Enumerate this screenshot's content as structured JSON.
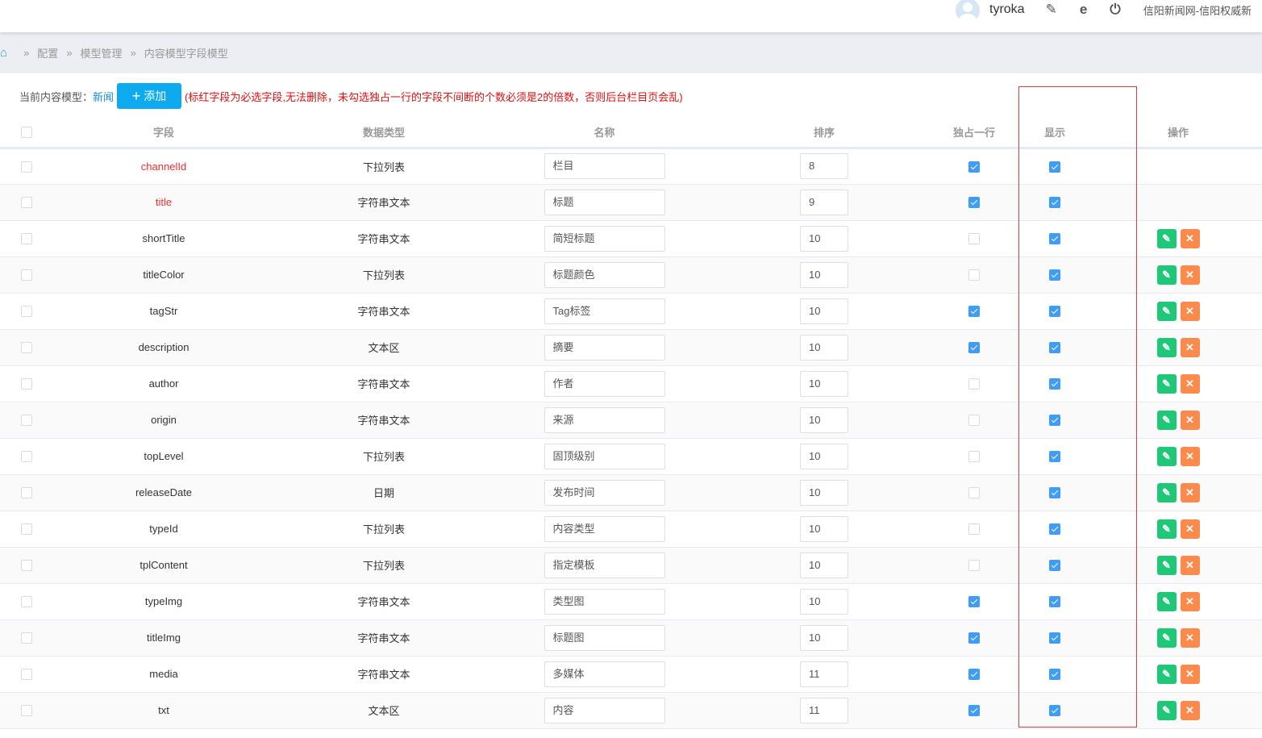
{
  "header": {
    "user": "tyroka",
    "site_title": "信阳新闻网-信阳权威新",
    "icons": [
      "user-avatar",
      "user-edit-icon",
      "ie-browser-icon",
      "power-icon"
    ]
  },
  "breadcrumb": [
    "配置",
    "模型管理",
    "内容模型字段模型"
  ],
  "toolbar": {
    "label": "当前内容模型：",
    "model": "新闻",
    "add_label": "添加",
    "warning": "(标红字段为必选字段,无法删除，未勾选独占一行的字段不间断的个数必须是2的倍数，否则后台栏目页会乱)"
  },
  "columns": [
    "字段",
    "数据类型",
    "名称",
    "排序",
    "独占一行",
    "显示",
    "操作"
  ],
  "colors": {
    "accent": "#0eaaf0",
    "required": "#f03030",
    "edit": "#1ec877",
    "delete": "#fd8a4d",
    "checkbox": "#3f9df5"
  },
  "rows": [
    {
      "field": "channelId",
      "type": "下拉列表",
      "name": "栏目",
      "order": "8",
      "exclusive": true,
      "show": true,
      "required": true
    },
    {
      "field": "title",
      "type": "字符串文本",
      "name": "标题",
      "order": "9",
      "exclusive": true,
      "show": true,
      "required": true
    },
    {
      "field": "shortTitle",
      "type": "字符串文本",
      "name": "简短标题",
      "order": "10",
      "exclusive": false,
      "show": true,
      "required": false
    },
    {
      "field": "titleColor",
      "type": "下拉列表",
      "name": "标题颜色",
      "order": "10",
      "exclusive": false,
      "show": true,
      "required": false
    },
    {
      "field": "tagStr",
      "type": "字符串文本",
      "name": "Tag标签",
      "order": "10",
      "exclusive": true,
      "show": true,
      "required": false
    },
    {
      "field": "description",
      "type": "文本区",
      "name": "摘要",
      "order": "10",
      "exclusive": true,
      "show": true,
      "required": false
    },
    {
      "field": "author",
      "type": "字符串文本",
      "name": "作者",
      "order": "10",
      "exclusive": false,
      "show": true,
      "required": false
    },
    {
      "field": "origin",
      "type": "字符串文本",
      "name": "来源",
      "order": "10",
      "exclusive": false,
      "show": true,
      "required": false
    },
    {
      "field": "topLevel",
      "type": "下拉列表",
      "name": "固顶级别",
      "order": "10",
      "exclusive": false,
      "show": true,
      "required": false
    },
    {
      "field": "releaseDate",
      "type": "日期",
      "name": "发布时间",
      "order": "10",
      "exclusive": false,
      "show": true,
      "required": false
    },
    {
      "field": "typeId",
      "type": "下拉列表",
      "name": "内容类型",
      "order": "10",
      "exclusive": false,
      "show": true,
      "required": false
    },
    {
      "field": "tplContent",
      "type": "下拉列表",
      "name": "指定模板",
      "order": "10",
      "exclusive": false,
      "show": true,
      "required": false
    },
    {
      "field": "typeImg",
      "type": "字符串文本",
      "name": "类型图",
      "order": "10",
      "exclusive": true,
      "show": true,
      "required": false
    },
    {
      "field": "titleImg",
      "type": "字符串文本",
      "name": "标题图",
      "order": "10",
      "exclusive": true,
      "show": true,
      "required": false
    },
    {
      "field": "media",
      "type": "字符串文本",
      "name": "多媒体",
      "order": "11",
      "exclusive": true,
      "show": true,
      "required": false
    },
    {
      "field": "txt",
      "type": "文本区",
      "name": "内容",
      "order": "11",
      "exclusive": true,
      "show": true,
      "required": false
    }
  ]
}
